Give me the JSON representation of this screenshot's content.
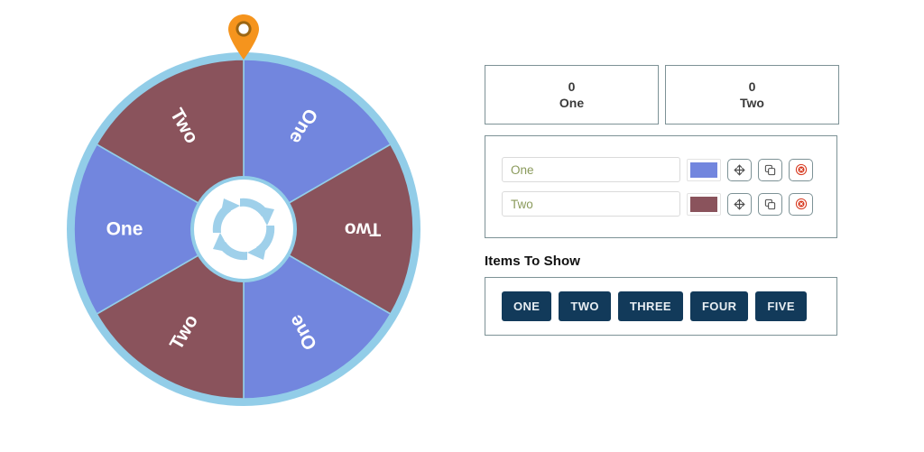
{
  "wheel": {
    "pointer_icon": "map-pin-pointer-icon",
    "hub_icon": "spin-refresh-icon",
    "rim_color": "#92cde8",
    "hub_fill": "#ffffff",
    "segments": [
      {
        "label": "One",
        "color": "#7286de"
      },
      {
        "label": "Two",
        "color": "#8a535c"
      },
      {
        "label": "One",
        "color": "#7286de"
      },
      {
        "label": "Two",
        "color": "#8a535c"
      },
      {
        "label": "One",
        "color": "#7286de"
      },
      {
        "label": "Two",
        "color": "#8a535c"
      }
    ]
  },
  "counters": [
    {
      "value": "0",
      "label": "One"
    },
    {
      "value": "0",
      "label": "Two"
    }
  ],
  "items": [
    {
      "name": "One",
      "color": "#7286de",
      "move_icon": "arrows-move-icon",
      "duplicate_icon": "copy-duplicate-icon",
      "delete_icon": "circle-x-delete-icon"
    },
    {
      "name": "Two",
      "color": "#8a535c",
      "move_icon": "arrows-move-icon",
      "duplicate_icon": "copy-duplicate-icon",
      "delete_icon": "circle-x-delete-icon"
    }
  ],
  "items_to_show": {
    "title": "Items To Show",
    "options": [
      "ONE",
      "TWO",
      "THREE",
      "FOUR",
      "FIVE"
    ]
  }
}
